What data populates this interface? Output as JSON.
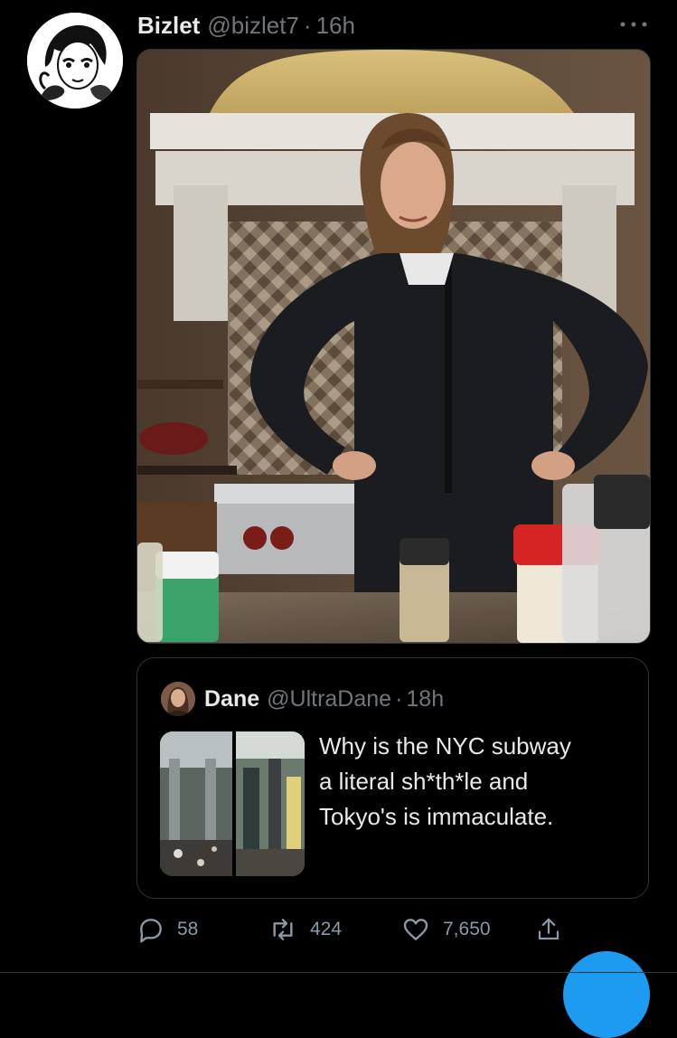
{
  "tweet": {
    "author_name": "Bizlet",
    "author_handle": "@bizlet7",
    "separator": "·",
    "time": "16h",
    "avatar_icon": "manga-portrait-avatar",
    "media_icon": "photo-woman-in-kitchen"
  },
  "quote": {
    "author_name": "Dane",
    "author_handle": "@UltraDane",
    "separator": "·",
    "time": "18h",
    "text_lines": [
      "Why is the NYC subway",
      "a literal sh*th*le and",
      "Tokyo's is immaculate."
    ],
    "thumb_icon": "photo-subway-cars"
  },
  "actions": {
    "reply_count": "58",
    "retweet_count": "424",
    "like_count": "7,650"
  },
  "colors": {
    "background": "#000000",
    "text": "#e7e9ea",
    "muted": "#71767b",
    "accent": "#1d9bf0",
    "border": "#2f3336"
  }
}
